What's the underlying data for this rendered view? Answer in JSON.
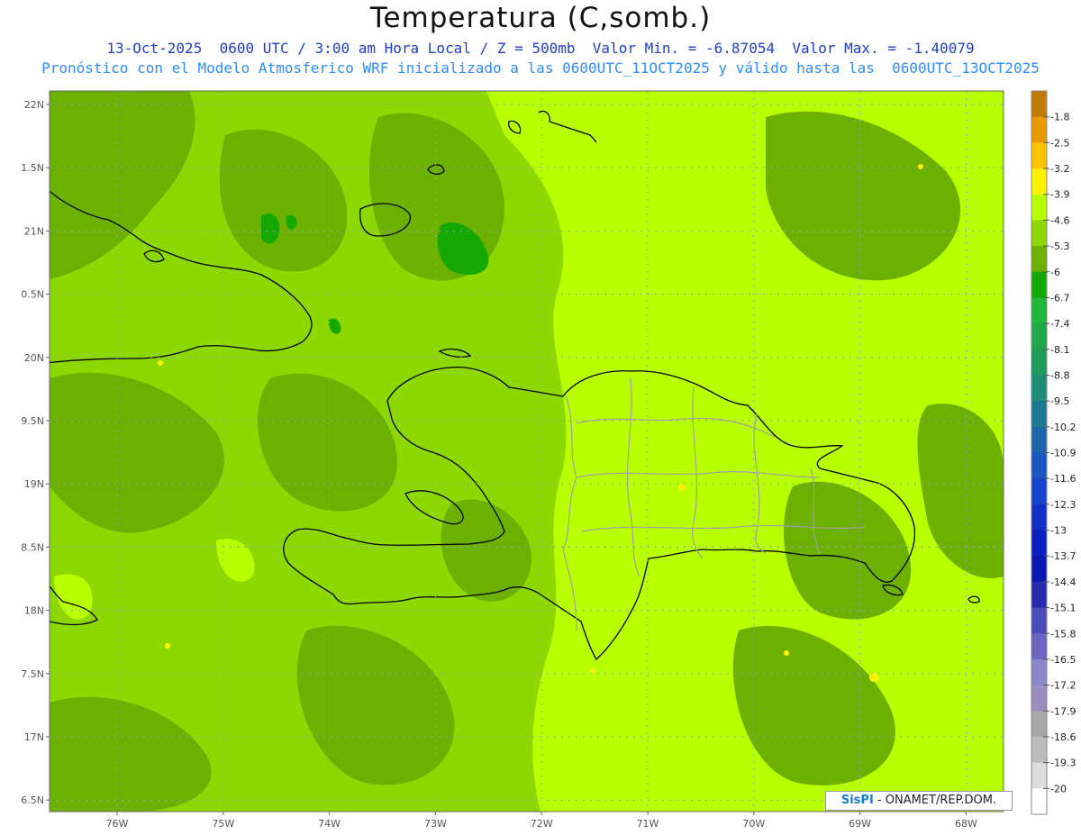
{
  "header": {
    "title": "Temperatura (C,somb.)",
    "subtitle1": "13-Oct-2025  0600 UTC / 3:00 am Hora Local / Z = 500mb  Valor Min. = -6.87054  Valor Max. = -1.40079",
    "subtitle2": "Pronóstico con el Modelo Atmosferico WRF inicializado a las 0600UTC_11OCT2025 y válido hasta las  0600UTC_13OCT2025"
  },
  "axes": {
    "lat_labels": [
      "22N",
      "1.5N",
      "21N",
      "0.5N",
      "20N",
      "9.5N",
      "19N",
      "8.5N",
      "18N",
      "7.5N",
      "17N",
      "6.5N"
    ],
    "lon_labels": [
      "76W",
      "75W",
      "74W",
      "73W",
      "72W",
      "71W",
      "70W",
      "69W",
      "68W"
    ]
  },
  "colorbar": {
    "labels": [
      "-1.8",
      "-2.5",
      "-3.2",
      "-3.9",
      "-4.6",
      "-5.3",
      "-6",
      "-6.7",
      "-7.4",
      "-8.1",
      "-8.8",
      "-9.5",
      "-10.2",
      "-10.9",
      "-11.6",
      "-12.3",
      "-13",
      "-13.7",
      "-14.4",
      "-15.1",
      "-15.8",
      "-16.5",
      "-17.2",
      "-17.9",
      "-18.6",
      "-19.3",
      "-20"
    ],
    "colors": [
      "#c07a00",
      "#e89a00",
      "#ffc400",
      "#fff200",
      "#b8ff00",
      "#8cd800",
      "#6cb000",
      "#14a800",
      "#1fb83a",
      "#20a848",
      "#1f9a5a",
      "#1f8c78",
      "#1d7a92",
      "#1b66a8",
      "#1a55c0",
      "#1744cc",
      "#1030c8",
      "#0a20c0",
      "#0818b0",
      "#2a2ab0",
      "#4a4ab8",
      "#6868c0",
      "#8888c8",
      "#9c8cc4",
      "#a8a8a8",
      "#bcbcbc",
      "#dcdcdc",
      "#ffffff"
    ]
  },
  "field_colors": {
    "base": "#8cd800",
    "dark": "#6cb000",
    "darker": "#14a800",
    "light": "#b8ff00",
    "lighter": "#fff200",
    "border_country": "#000000",
    "border_province": "#a0a0a0"
  },
  "credit": {
    "logo": "SisPI",
    "text": " - ONAMET/REP.DOM."
  }
}
